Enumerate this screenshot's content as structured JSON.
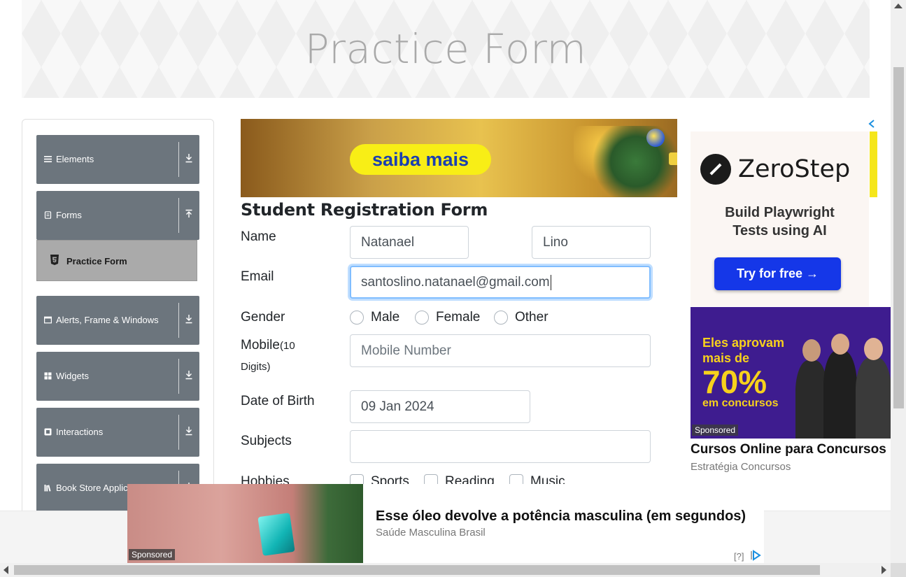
{
  "header": {
    "title": "Practice Form"
  },
  "sidebar": {
    "groups": [
      {
        "label": "Elements",
        "icon": "menu-icon",
        "arrow": "download-arrow-icon"
      },
      {
        "label": "Forms",
        "icon": "form-icon",
        "arrow": "upload-arrow-icon"
      },
      {
        "label": "Alerts, Frame & Windows",
        "icon": "window-icon",
        "arrow": "download-arrow-icon"
      },
      {
        "label": "Widgets",
        "icon": "grid-icon",
        "arrow": "download-arrow-icon"
      },
      {
        "label": "Interactions",
        "icon": "interaction-icon",
        "arrow": "download-arrow-icon"
      },
      {
        "label": "Book Store Applicat",
        "icon": "books-icon",
        "arrow": "download-arrow-icon"
      }
    ],
    "active_item": {
      "label": "Practice Form",
      "icon": "html5-icon"
    }
  },
  "ad_top": {
    "cta": "saiba mais"
  },
  "form": {
    "title": "Student Registration Form",
    "name_label": "Name",
    "first_name": "Natanael",
    "last_name": "Lino",
    "email_label": "Email",
    "email_value": "santoslino.natanael@gmail.com",
    "gender_label": "Gender",
    "gender_options": [
      "Male",
      "Female",
      "Other"
    ],
    "mobile_label": "Mobile",
    "mobile_hint": "(10",
    "mobile_hint2": "Digits)",
    "mobile_placeholder": "Mobile Number",
    "dob_label": "Date of Birth",
    "dob_value": "09 Jan 2024",
    "subjects_label": "Subjects",
    "subjects_value": "",
    "hobbies_label": "Hobbies",
    "hobby_options": [
      "Sports",
      "Reading",
      "Music"
    ]
  },
  "ad_right": {
    "brand": "ZeroStep",
    "tagline1": "Build Playwright",
    "tagline2": "Tests using AI",
    "cta": "Try for free →",
    "promo_line1": "Eles aprovam",
    "promo_line2": "mais de",
    "promo_big": "70%",
    "promo_line3": "em concursos",
    "sponsored": "Sponsored",
    "title": "Cursos Online para Concursos",
    "source": "Estratégia Concursos",
    "adchoices_icon": "adchoices-arrow-icon"
  },
  "ad_bottom": {
    "sponsored": "Sponsored",
    "headline": "Esse óleo devolve a potência masculina (em segundos)",
    "source": "Saúde Masculina Brasil",
    "help": "[?]"
  },
  "colors": {
    "sidebar_group": "#6c757d",
    "sidebar_active": "#aaaaaa",
    "focus_border": "#80bdff",
    "zerostep_button": "#1537e8",
    "concursos_bg": "#3e1c8f",
    "concursos_text": "#f7d11c"
  }
}
